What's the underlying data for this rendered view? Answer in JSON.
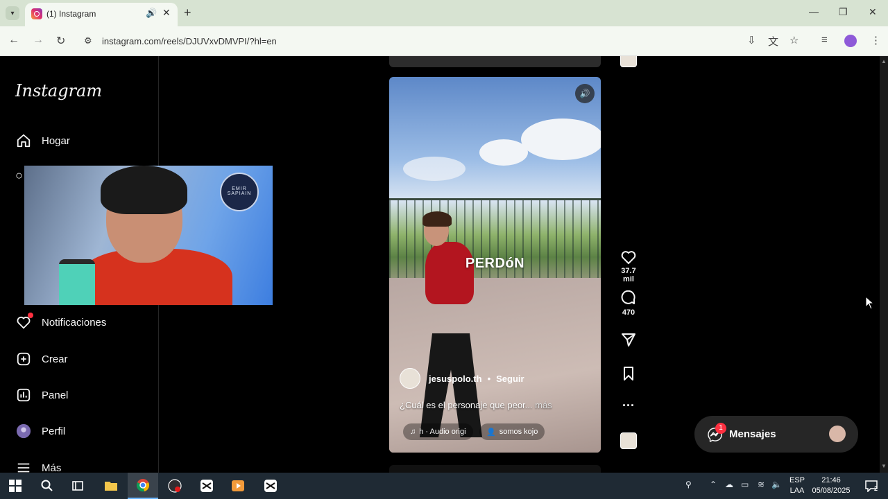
{
  "browser": {
    "tab_title": "(1) Instagram",
    "url": "instagram.com/reels/DJUVxvDMVPI/?hl=en"
  },
  "sidebar": {
    "logo": "Instagram",
    "items": [
      {
        "label": "Hogar",
        "icon": "home-icon"
      },
      {
        "label": "Notificaciones",
        "icon": "heart-icon"
      },
      {
        "label": "Crear",
        "icon": "plus-square-icon"
      },
      {
        "label": "Panel",
        "icon": "chart-icon"
      },
      {
        "label": "Perfil",
        "icon": "avatar-icon"
      },
      {
        "label": "Más",
        "icon": "hamburger-icon"
      }
    ]
  },
  "webcam": {
    "badge_line1": "EMIR",
    "badge_line2": "SAPIAIN"
  },
  "reel": {
    "overlay_text": "PERDóN",
    "username": "jesuspolo.th",
    "separator": "•",
    "follow_label": "Seguir",
    "caption": "¿Cuál es el personaje que peor",
    "caption_more": "... más",
    "audio_label": "h · Audio origi",
    "tagged_user": "somos kojo"
  },
  "actions": {
    "likes": "37.7 mil",
    "comments": "470"
  },
  "messages": {
    "label": "Mensajes",
    "badge": "1"
  },
  "taskbar": {
    "lang_line1": "ESP",
    "lang_line2": "LAA",
    "time": "21:46",
    "date": "05/08/2025",
    "notification_count": "2"
  }
}
